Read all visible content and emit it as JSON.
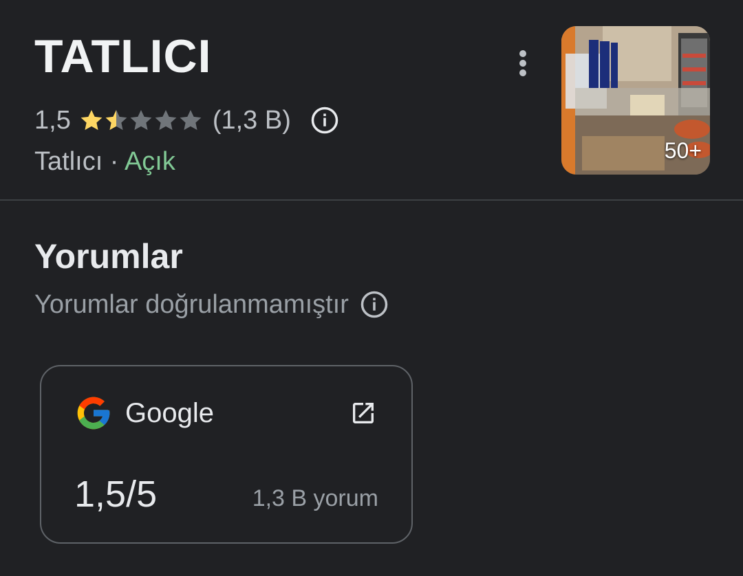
{
  "place": {
    "name": "TATLICI",
    "rating": "1,5",
    "rating_value": 1.5,
    "stars_max": 5,
    "review_count": "(1,3 B)",
    "category": "Tatlıcı",
    "separator": " · ",
    "status": "Açık",
    "status_color": "#81c995",
    "star_color": "#fdd663",
    "photo_count": "50+"
  },
  "reviews_section": {
    "title": "Yorumlar",
    "subtitle": "Yorumlar doğrulanmamıştır"
  },
  "review_card": {
    "source": "Google",
    "score": "1,5/5",
    "count": "1,3 B yorum"
  },
  "icons": {
    "info": "info-icon",
    "more": "more-vert-icon",
    "open_external": "open-external-icon",
    "google": "google-logo-icon"
  }
}
